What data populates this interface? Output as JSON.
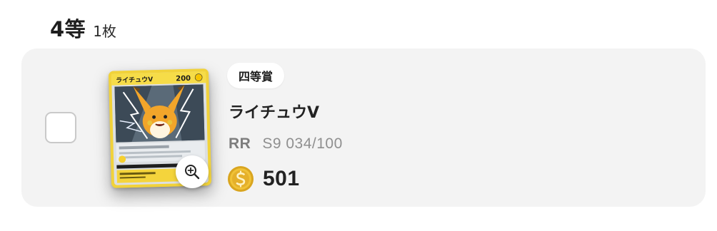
{
  "section": {
    "grade": "4等",
    "count": "1枚"
  },
  "prize": {
    "rank_label": "四等賞",
    "card_name": "ライチュウV",
    "rarity": "RR",
    "card_number": "S9 034/100",
    "points": "501",
    "selected": false,
    "card_art": {
      "name": "ライチュウV",
      "hp": "200"
    }
  },
  "icons": {
    "checkbox": "checkbox-empty",
    "zoom": "zoom-in-icon",
    "coin": "coin-icon"
  },
  "colors": {
    "card_background": "#f3f3f3",
    "coin_gold": "#e8b92a",
    "card_yellow": "#f3d53a"
  }
}
